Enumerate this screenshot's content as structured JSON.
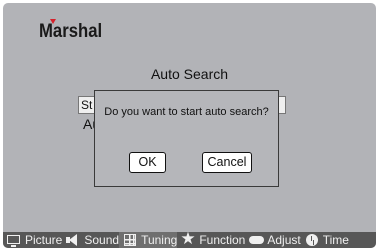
{
  "brand": {
    "logo_text": "Marshal"
  },
  "menu": {
    "title": "Auto Search",
    "background_button_label": "St",
    "background_item_label": "Au"
  },
  "dialog": {
    "message": "Do you want to start auto search?",
    "ok_label": "OK",
    "cancel_label": "Cancel"
  },
  "menubar": {
    "items": [
      {
        "label": "Picture",
        "icon": "monitor-icon"
      },
      {
        "label": "Sound",
        "icon": "speaker-icon"
      },
      {
        "label": "Tuning",
        "icon": "grid-icon",
        "selected": true
      },
      {
        "label": "Function",
        "icon": "star-icon"
      },
      {
        "label": "Adjust",
        "icon": "adjust-icon"
      },
      {
        "label": "Time",
        "icon": "clock-icon"
      }
    ]
  },
  "colors": {
    "screen_bg": "#b2b3b7",
    "menubar_bg": "#575757",
    "logo_accent": "#d6212b"
  }
}
